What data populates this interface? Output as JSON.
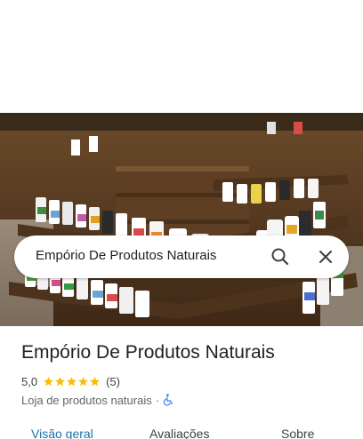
{
  "search": {
    "query": "Empório De Produtos Naturais"
  },
  "place": {
    "name": "Empório De Produtos Naturais",
    "rating": "5,0",
    "stars": 5,
    "review_count": "(5)",
    "category": "Loja de produtos naturais",
    "separator": "·"
  },
  "tabs": [
    {
      "label": "Visão geral",
      "active": true
    },
    {
      "label": "Avaliações",
      "active": false
    },
    {
      "label": "Sobre",
      "active": false
    }
  ],
  "colors": {
    "accent": "#1a73a8",
    "star": "#fbbc04",
    "accessibility_icon": "#4285f4"
  },
  "icons": {
    "search": "search-icon",
    "close": "close-icon",
    "accessibility": "wheelchair-icon"
  }
}
